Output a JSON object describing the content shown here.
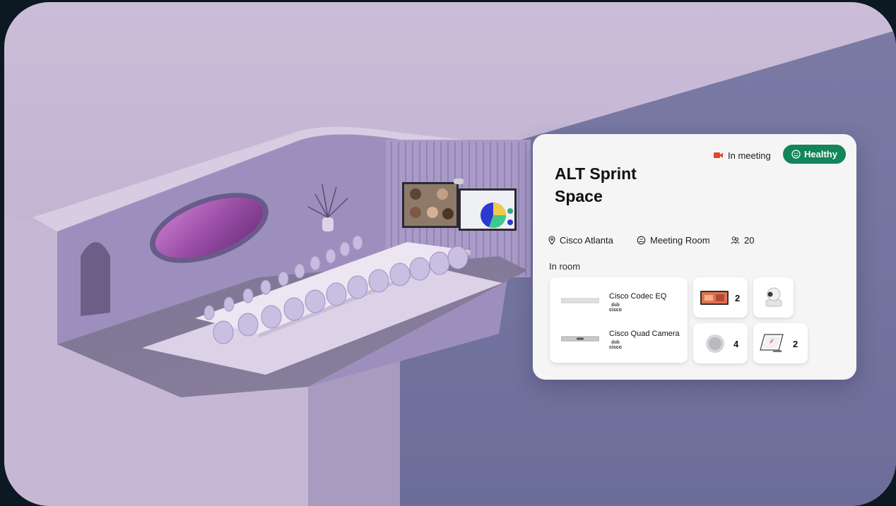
{
  "room": {
    "title_line1": "ALT Sprint",
    "title_line2": "Space",
    "meeting_status": "In meeting",
    "health_status": "Healthy",
    "location": "Cisco Atlanta",
    "room_type": "Meeting Room",
    "capacity": "20"
  },
  "in_room": {
    "label": "In room",
    "devices": [
      {
        "name": "Cisco Codec EQ",
        "brand": "cisco"
      },
      {
        "name": "Cisco Quad Camera",
        "brand": "cisco"
      }
    ],
    "tiles": [
      {
        "icon": "display-icon",
        "count": "2"
      },
      {
        "icon": "ptz-camera-icon",
        "count": ""
      },
      {
        "icon": "microphone-icon",
        "count": "4"
      },
      {
        "icon": "touch-panel-icon",
        "count": "2"
      }
    ]
  },
  "colors": {
    "healthy": "#12855a",
    "in_meeting": "#e2462b",
    "room_wall": "#9d8fbd"
  }
}
